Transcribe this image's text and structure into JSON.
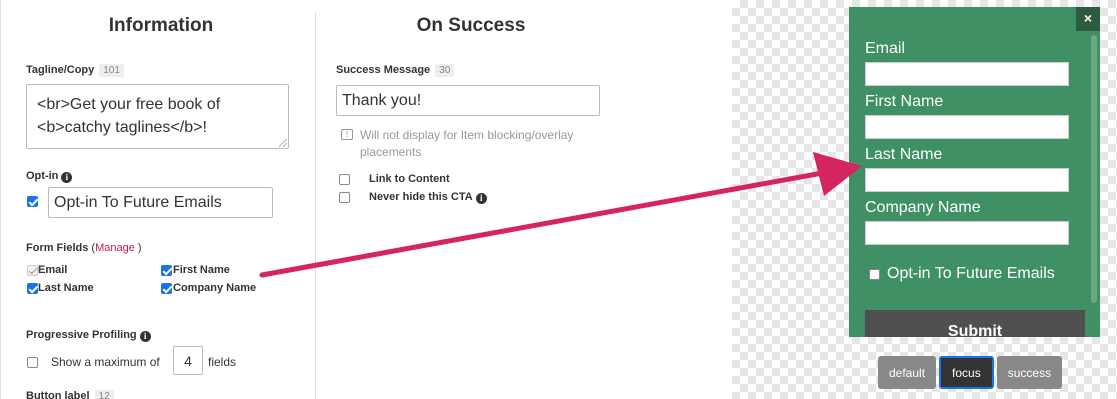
{
  "information": {
    "title": "Information",
    "tagline": {
      "label": "Tagline/Copy",
      "count": "101",
      "value_line1": "<br>Get your free book of",
      "value_line2": "<b>catchy taglines</b>!"
    },
    "optin": {
      "label": "Opt-in",
      "checked": true,
      "value": "Opt-in To Future Emails"
    },
    "form_fields": {
      "label": "Form Fields",
      "open_paren": "(",
      "manage_link": "Manage",
      "close_paren": ")",
      "fields": [
        {
          "label": "Email",
          "checked": true,
          "disabled": true
        },
        {
          "label": "First Name",
          "checked": true,
          "disabled": false
        },
        {
          "label": "Last Name",
          "checked": true,
          "disabled": false
        },
        {
          "label": "Company Name",
          "checked": true,
          "disabled": false
        }
      ]
    },
    "progressive": {
      "label": "Progressive Profiling",
      "prefix": "Show a maximum of",
      "value": "4",
      "suffix": "fields",
      "checked": false
    },
    "button_label": {
      "label": "Button label",
      "count": "12"
    }
  },
  "on_success": {
    "title": "On Success",
    "message": {
      "label": "Success Message",
      "count": "30",
      "value": "Thank you!"
    },
    "note_line1": "Will not display for Item blocking/overlay",
    "note_line2": "placements",
    "link_to_content": "Link to Content",
    "never_hide": "Never hide this CTA"
  },
  "preview": {
    "close": "×",
    "fields": [
      "Email",
      "First Name",
      "Last Name",
      "Company Name"
    ],
    "optin_label": "Opt-in To Future Emails",
    "submit": "Submit",
    "states": [
      "default",
      "focus",
      "success"
    ],
    "active_state": "focus",
    "colors": {
      "form_bg": "#3f9065",
      "submit_bg": "#505050",
      "arrow": "#d6245f"
    }
  }
}
